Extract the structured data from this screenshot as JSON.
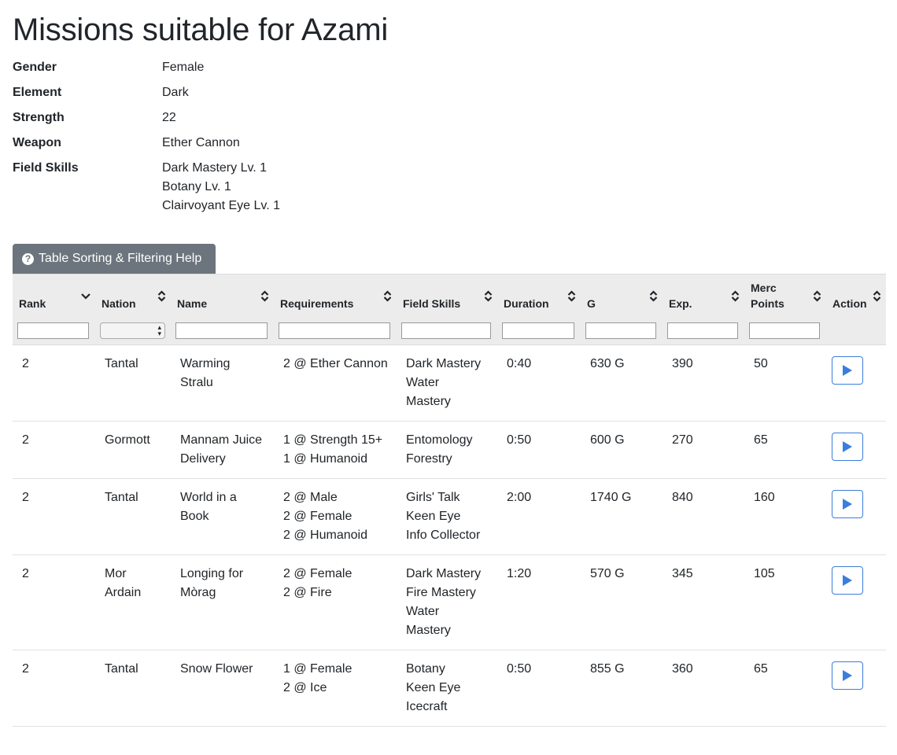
{
  "title": "Missions suitable for Azami",
  "info": [
    {
      "label": "Gender",
      "values": [
        "Female"
      ]
    },
    {
      "label": "Element",
      "values": [
        "Dark"
      ]
    },
    {
      "label": "Strength",
      "values": [
        "22"
      ]
    },
    {
      "label": "Weapon",
      "values": [
        "Ether Cannon"
      ]
    },
    {
      "label": "Field Skills",
      "values": [
        "Dark Mastery Lv. 1",
        "Botany Lv. 1",
        "Clairvoyant Eye Lv. 1"
      ]
    }
  ],
  "help_button": {
    "label": "Table Sorting & Filtering Help",
    "icon": "question-circle-icon"
  },
  "columns": [
    {
      "key": "rank",
      "label": "Rank",
      "sort": "down"
    },
    {
      "key": "nation",
      "label": "Nation",
      "sort": "both"
    },
    {
      "key": "name",
      "label": "Name",
      "sort": "both"
    },
    {
      "key": "requirements",
      "label": "Requirements",
      "sort": "both"
    },
    {
      "key": "field_skills",
      "label": "Field Skills",
      "sort": "both"
    },
    {
      "key": "duration",
      "label": "Duration",
      "sort": "both"
    },
    {
      "key": "g",
      "label": "G",
      "sort": "both"
    },
    {
      "key": "exp",
      "label": "Exp.",
      "sort": "both"
    },
    {
      "key": "merc",
      "label": "Merc Points",
      "sort": "both"
    },
    {
      "key": "action",
      "label": "Action",
      "sort": "both"
    }
  ],
  "rows": [
    {
      "rank": "2",
      "nation": [
        "Tantal"
      ],
      "name": [
        "Warming",
        "Stralu"
      ],
      "requirements": [
        "2 @ Ether Cannon"
      ],
      "field_skills": [
        "Dark Mastery",
        "Water",
        "Mastery"
      ],
      "duration": "0:40",
      "g": "630 G",
      "exp": "390",
      "merc": "50"
    },
    {
      "rank": "2",
      "nation": [
        "Gormott"
      ],
      "name": [
        "Mannam Juice",
        "Delivery"
      ],
      "requirements": [
        "1 @ Strength 15+",
        "1 @ Humanoid"
      ],
      "field_skills": [
        "Entomology",
        "Forestry"
      ],
      "duration": "0:50",
      "g": "600 G",
      "exp": "270",
      "merc": "65"
    },
    {
      "rank": "2",
      "nation": [
        "Tantal"
      ],
      "name": [
        "World in a",
        "Book"
      ],
      "requirements": [
        "2 @ Male",
        "2 @ Female",
        "2 @ Humanoid"
      ],
      "field_skills": [
        "Girls' Talk",
        "Keen Eye",
        "Info Collector"
      ],
      "duration": "2:00",
      "g": "1740 G",
      "exp": "840",
      "merc": "160"
    },
    {
      "rank": "2",
      "nation": [
        "Mor",
        "Ardain"
      ],
      "name": [
        "Longing for",
        "Mòrag"
      ],
      "requirements": [
        "2 @ Female",
        "2 @ Fire"
      ],
      "field_skills": [
        "Dark Mastery",
        "Fire Mastery",
        "Water",
        "Mastery"
      ],
      "duration": "1:20",
      "g": "570 G",
      "exp": "345",
      "merc": "105"
    },
    {
      "rank": "2",
      "nation": [
        "Tantal"
      ],
      "name": [
        "Snow Flower"
      ],
      "requirements": [
        "1 @ Female",
        "2 @ Ice"
      ],
      "field_skills": [
        "Botany",
        "Keen Eye",
        "Icecraft"
      ],
      "duration": "0:50",
      "g": "855 G",
      "exp": "360",
      "merc": "65"
    }
  ],
  "colors": {
    "help_button_bg": "#6c757d",
    "header_bg": "#ececec",
    "play_accent": "#3b7ddd"
  }
}
